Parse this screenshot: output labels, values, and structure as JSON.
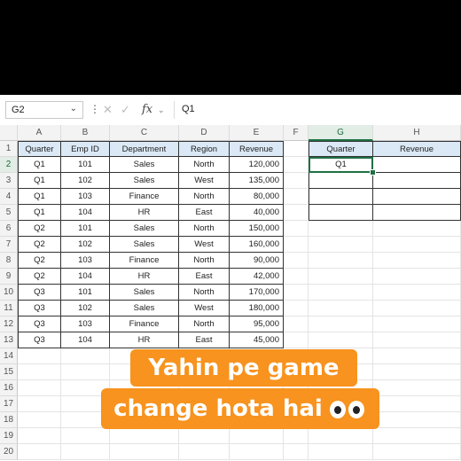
{
  "formula_bar": {
    "name_box": "G2",
    "formula": "Q1",
    "icons": [
      "chevron-down-icon",
      "more-icon",
      "cancel-icon",
      "enter-icon",
      "function-icon"
    ]
  },
  "columns": [
    "A",
    "B",
    "C",
    "D",
    "E",
    "F",
    "G",
    "H"
  ],
  "rows": [
    "1",
    "2",
    "3",
    "4",
    "5",
    "6",
    "7",
    "8",
    "9",
    "10",
    "11",
    "12",
    "13",
    "14",
    "15",
    "16",
    "17",
    "18",
    "19",
    "20"
  ],
  "table": {
    "headers": [
      "Quarter",
      "Emp ID",
      "Department",
      "Region",
      "Revenue"
    ],
    "rows": [
      [
        "Q1",
        "101",
        "Sales",
        "North",
        "120,000"
      ],
      [
        "Q1",
        "102",
        "Sales",
        "West",
        "135,000"
      ],
      [
        "Q1",
        "103",
        "Finance",
        "North",
        "80,000"
      ],
      [
        "Q1",
        "104",
        "HR",
        "East",
        "40,000"
      ],
      [
        "Q2",
        "101",
        "Sales",
        "North",
        "150,000"
      ],
      [
        "Q2",
        "102",
        "Sales",
        "West",
        "160,000"
      ],
      [
        "Q2",
        "103",
        "Finance",
        "North",
        "90,000"
      ],
      [
        "Q2",
        "104",
        "HR",
        "East",
        "42,000"
      ],
      [
        "Q3",
        "101",
        "Sales",
        "North",
        "170,000"
      ],
      [
        "Q3",
        "102",
        "Sales",
        "West",
        "180,000"
      ],
      [
        "Q3",
        "103",
        "Finance",
        "North",
        "95,000"
      ],
      [
        "Q3",
        "104",
        "HR",
        "East",
        "45,000"
      ]
    ]
  },
  "summary": {
    "headers": [
      "Quarter",
      "Revenue"
    ],
    "rows": [
      [
        "Q1",
        ""
      ],
      [
        "",
        ""
      ],
      [
        "",
        ""
      ],
      [
        "",
        ""
      ]
    ]
  },
  "overlay": {
    "line1": "Yahin pe game",
    "line2": "change hota hai",
    "emoji": "eyes-icon"
  },
  "colors": {
    "accent": "#1e7145",
    "header_fill": "#dbe9f6",
    "overlay": "#f7931e"
  }
}
